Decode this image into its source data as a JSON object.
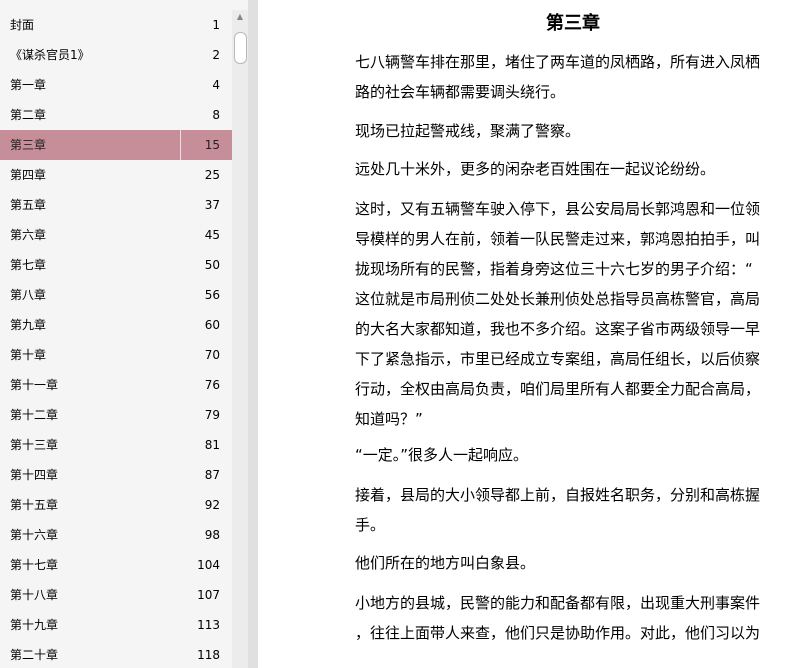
{
  "toc": {
    "items": [
      {
        "title": "封面",
        "page": "1"
      },
      {
        "title": "《谋杀官员1》",
        "page": "2"
      },
      {
        "title": "第一章",
        "page": "4"
      },
      {
        "title": "第二章",
        "page": "8"
      },
      {
        "title": "第三章",
        "page": "15",
        "selected": true
      },
      {
        "title": "第四章",
        "page": "25"
      },
      {
        "title": "第五章",
        "page": "37"
      },
      {
        "title": "第六章",
        "page": "45"
      },
      {
        "title": "第七章",
        "page": "50"
      },
      {
        "title": "第八章",
        "page": "56"
      },
      {
        "title": "第九章",
        "page": "60"
      },
      {
        "title": "第十章",
        "page": "70"
      },
      {
        "title": "第十一章",
        "page": "76"
      },
      {
        "title": "第十二章",
        "page": "79"
      },
      {
        "title": "第十三章",
        "page": "81"
      },
      {
        "title": "第十四章",
        "page": "87"
      },
      {
        "title": "第十五章",
        "page": "92"
      },
      {
        "title": "第十六章",
        "page": "98"
      },
      {
        "title": "第十七章",
        "page": "104"
      },
      {
        "title": "第十八章",
        "page": "107"
      },
      {
        "title": "第十九章",
        "page": "113"
      },
      {
        "title": "第二十章",
        "page": "118"
      }
    ]
  },
  "colors": {
    "selected_row": "#c68e98",
    "panel_bg": "#f5f5f5"
  },
  "content": {
    "chapter_title": "第三章",
    "paragraphs": [
      {
        "lines": [
          "七八辆警车排在那里，堵住了两车道的凤栖路，所有进入凤栖",
          "路的社会车辆都需要调头绕行。"
        ]
      },
      {
        "lines": [
          "现场已拉起警戒线，聚满了警察。"
        ]
      },
      {
        "lines": [
          "远处几十米外，更多的闲杂老百姓围在一起议论纷纷。"
        ]
      },
      {
        "lines": [
          "这时，又有五辆警车驶入停下，县公安局局长郭鸿恩和一位领",
          "导模样的男人在前，领着一队民警走过来，郭鸿恩拍拍手，叫",
          "拢现场所有的民警，指着身旁这位三十六七岁的男子介绍：“",
          "这位就是市局刑侦二处处长兼刑侦处总指导员高栋警官，高局",
          "的大名大家都知道，我也不多介绍。这案子省市两级领导一早",
          "下了紧急指示，市里已经成立专案组，高局任组长，以后侦察",
          "行动，全权由高局负责，咱们局里所有人都要全力配合高局，",
          "知道吗？”"
        ]
      },
      {
        "lines": [
          "“一定。”很多人一起响应。"
        ]
      },
      {
        "lines": [
          "接着，县局的大小领导都上前，自报姓名职务，分别和高栋握",
          "手。"
        ]
      },
      {
        "lines": [
          "他们所在的地方叫白象县。"
        ]
      },
      {
        "lines": [
          "小地方的县城，民警的能力和配备都有限，出现重大刑事案件",
          "，往往上面带人来查，他们只是协助作用。对此，他们习以为"
        ]
      }
    ]
  }
}
